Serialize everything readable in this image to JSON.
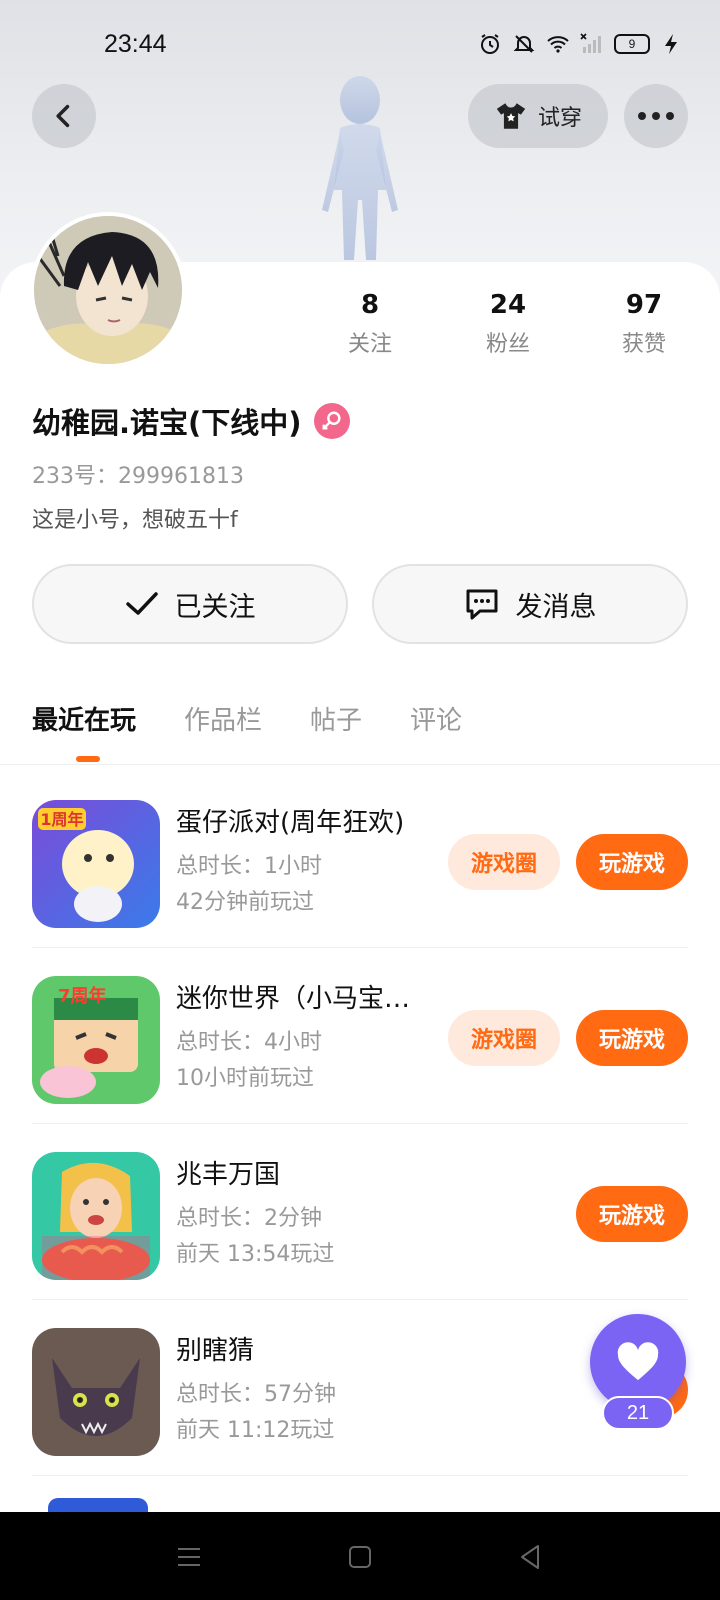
{
  "status_bar": {
    "time": "23:44",
    "battery": "9",
    "icons": [
      "alarm-icon",
      "mute-icon",
      "wifi-icon",
      "no-signal-icon",
      "battery-icon",
      "charging-icon"
    ]
  },
  "top_nav": {
    "try_on_label": "试穿"
  },
  "profile": {
    "name": "幼稚园.诺宝(下线中)",
    "id_line": "233号：299961813",
    "bio": "这是小号，想破五十f",
    "gender": "female"
  },
  "stats": [
    {
      "value": "8",
      "label": "关注"
    },
    {
      "value": "24",
      "label": "粉丝"
    },
    {
      "value": "97",
      "label": "获赞"
    }
  ],
  "actions": {
    "follow_label": "已关注",
    "message_label": "发消息"
  },
  "tabs": [
    {
      "label": "最近在玩",
      "active": true
    },
    {
      "label": "作品栏",
      "active": false
    },
    {
      "label": "帖子",
      "active": false
    },
    {
      "label": "评论",
      "active": false
    }
  ],
  "games": [
    {
      "title": "蛋仔派对(周年狂欢)",
      "duration": "总时长：1小时",
      "last_played": "42分钟前玩过",
      "circle_label": "游戏圈",
      "play_label": "玩游戏"
    },
    {
      "title": "迷你世界（小马宝…",
      "duration": "总时长：4小时",
      "last_played": "10小时前玩过",
      "circle_label": "游戏圈",
      "play_label": "玩游戏"
    },
    {
      "title": "兆丰万国",
      "duration": "总时长：2分钟",
      "last_played": "前天 13:54玩过",
      "play_label": "玩游戏"
    },
    {
      "title": "别瞎猜",
      "duration": "总时长：57分钟",
      "last_played": "前天 11:12玩过"
    }
  ],
  "fab": {
    "count": "21"
  },
  "colors": {
    "accent": "#ff6a13",
    "accent_light": "#ffe9dc",
    "fab": "#7b63f4",
    "gender_badge": "#f2678b"
  }
}
